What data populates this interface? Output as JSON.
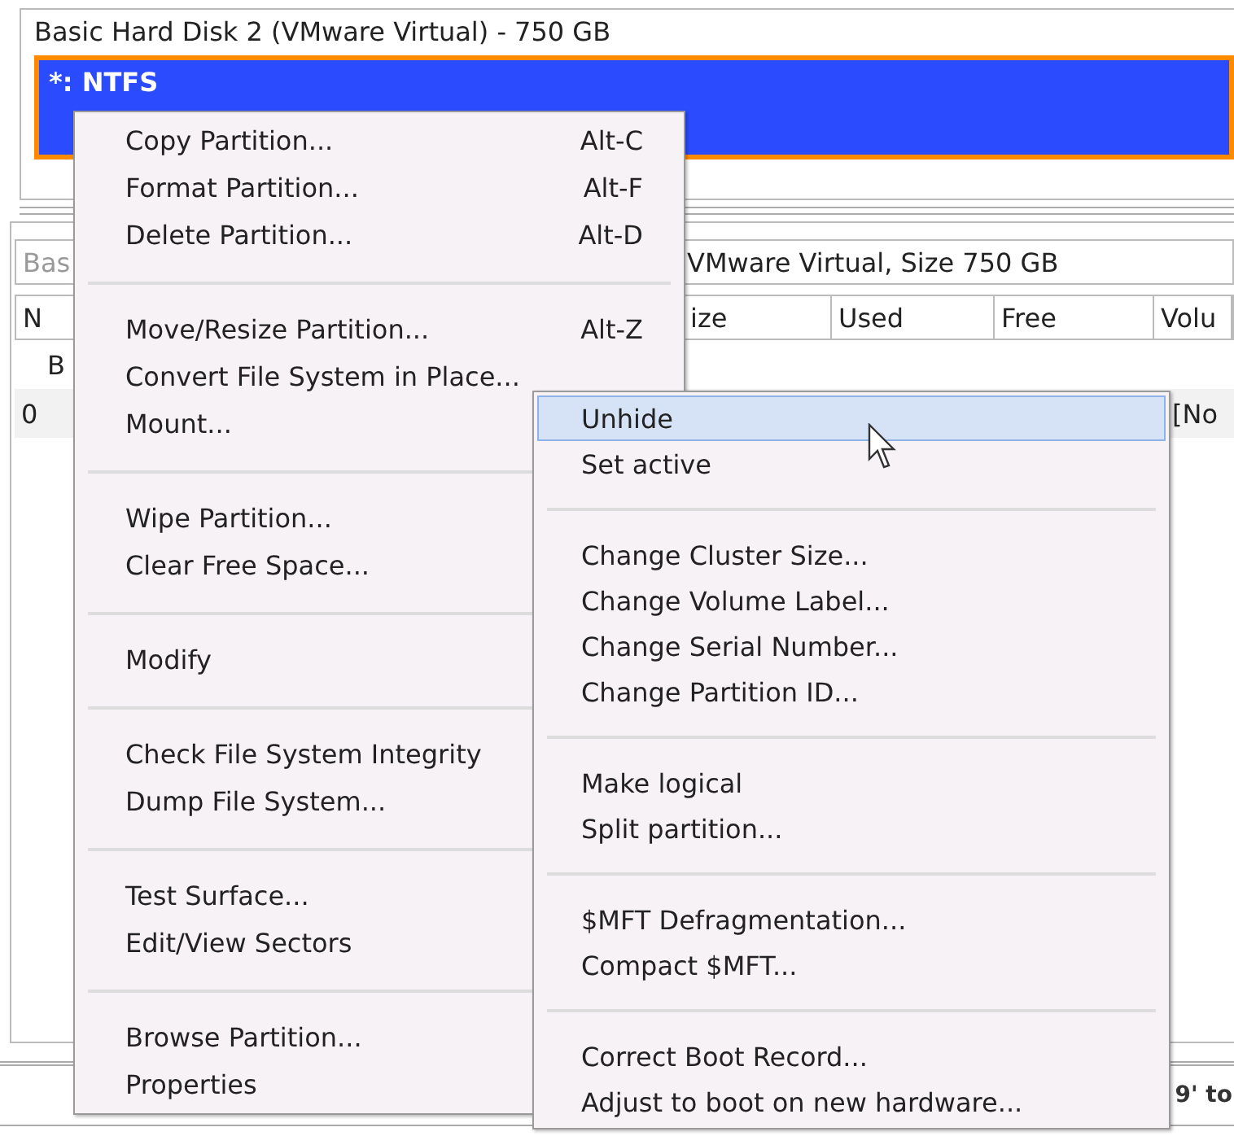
{
  "disk_map": {
    "title": "Basic Hard Disk 2 (VMware Virtual) - 750 GB",
    "partition": {
      "label": "*: NTFS",
      "selected": true
    }
  },
  "details": {
    "disk_field": [
      "Bas",
      "VMware Virtual, Size 750 GB"
    ],
    "columns": [
      "N",
      "ize",
      "Used",
      "Free",
      "Volu"
    ],
    "rows": [
      {
        "kind": "group",
        "cells": [
          "B"
        ]
      },
      {
        "kind": "partition",
        "cells": [
          "0",
          "",
          "",
          "",
          "[No"
        ]
      }
    ]
  },
  "status_bar": {
    "hint": "9' to"
  },
  "context_menu": {
    "items": [
      {
        "kind": "item",
        "label": "Copy Partition...",
        "shortcut": "Alt-C",
        "selected": false
      },
      {
        "kind": "item",
        "label": "Format Partition...",
        "shortcut": "Alt-F",
        "selected": false
      },
      {
        "kind": "item",
        "label": "Delete Partition...",
        "shortcut": "Alt-D",
        "selected": false
      },
      {
        "kind": "separator"
      },
      {
        "kind": "item",
        "label": "Move/Resize Partition...",
        "shortcut": "Alt-Z",
        "selected": false
      },
      {
        "kind": "item",
        "label": "Convert File System in Place...",
        "selected": false
      },
      {
        "kind": "item",
        "label": "Mount...",
        "selected": false
      },
      {
        "kind": "separator"
      },
      {
        "kind": "item",
        "label": "Wipe Partition...",
        "selected": false
      },
      {
        "kind": "item",
        "label": "Clear Free Space...",
        "selected": false
      },
      {
        "kind": "separator"
      },
      {
        "kind": "item",
        "label": "Modify",
        "selected": false
      },
      {
        "kind": "separator"
      },
      {
        "kind": "item",
        "label": "Check File System Integrity",
        "selected": false
      },
      {
        "kind": "item",
        "label": "Dump File System...",
        "selected": false
      },
      {
        "kind": "separator"
      },
      {
        "kind": "item",
        "label": "Test Surface...",
        "selected": false
      },
      {
        "kind": "item",
        "label": "Edit/View Sectors",
        "selected": false
      },
      {
        "kind": "separator"
      },
      {
        "kind": "item",
        "label": "Browse Partition...",
        "selected": false
      },
      {
        "kind": "item",
        "label": "Properties",
        "selected": false
      }
    ]
  },
  "submenu": {
    "items": [
      {
        "kind": "item",
        "label": "Unhide",
        "selected": true
      },
      {
        "kind": "item",
        "label": "Set active",
        "selected": false
      },
      {
        "kind": "separator"
      },
      {
        "kind": "item",
        "label": "Change Cluster Size...",
        "selected": false
      },
      {
        "kind": "item",
        "label": "Change Volume Label...",
        "selected": false
      },
      {
        "kind": "item",
        "label": "Change Serial Number...",
        "selected": false
      },
      {
        "kind": "item",
        "label": "Change Partition ID...",
        "selected": false
      },
      {
        "kind": "separator"
      },
      {
        "kind": "item",
        "label": "Make logical",
        "selected": false
      },
      {
        "kind": "item",
        "label": "Split partition...",
        "selected": false
      },
      {
        "kind": "separator"
      },
      {
        "kind": "item",
        "label": "$MFT Defragmentation...",
        "selected": false
      },
      {
        "kind": "item",
        "label": "Compact $MFT...",
        "selected": false
      },
      {
        "kind": "separator"
      },
      {
        "kind": "item",
        "label": "Correct Boot Record...",
        "selected": false
      },
      {
        "kind": "item",
        "label": "Adjust to boot on new hardware...",
        "selected": false
      }
    ]
  }
}
